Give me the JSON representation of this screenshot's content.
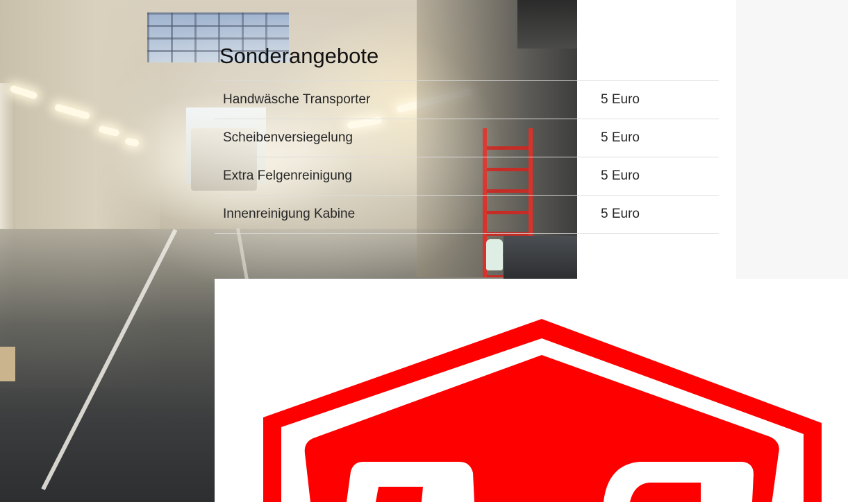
{
  "offers": {
    "title": "Sonderangebote",
    "rows": [
      {
        "name": "Handwäsche Transporter",
        "price": "5 Euro"
      },
      {
        "name": "Scheibenversiegelung",
        "price": "5 Euro"
      },
      {
        "name": "Extra Felgenreinigung",
        "price": "5 Euro"
      },
      {
        "name": "Innenreinigung Kabine",
        "price": "5 Euro"
      }
    ]
  },
  "colors": {
    "logo_red": "#ff0000",
    "background_gray": "#f7f7f7",
    "text": "#262626"
  },
  "icons": {
    "logo": "red-shield-logo-icon"
  }
}
